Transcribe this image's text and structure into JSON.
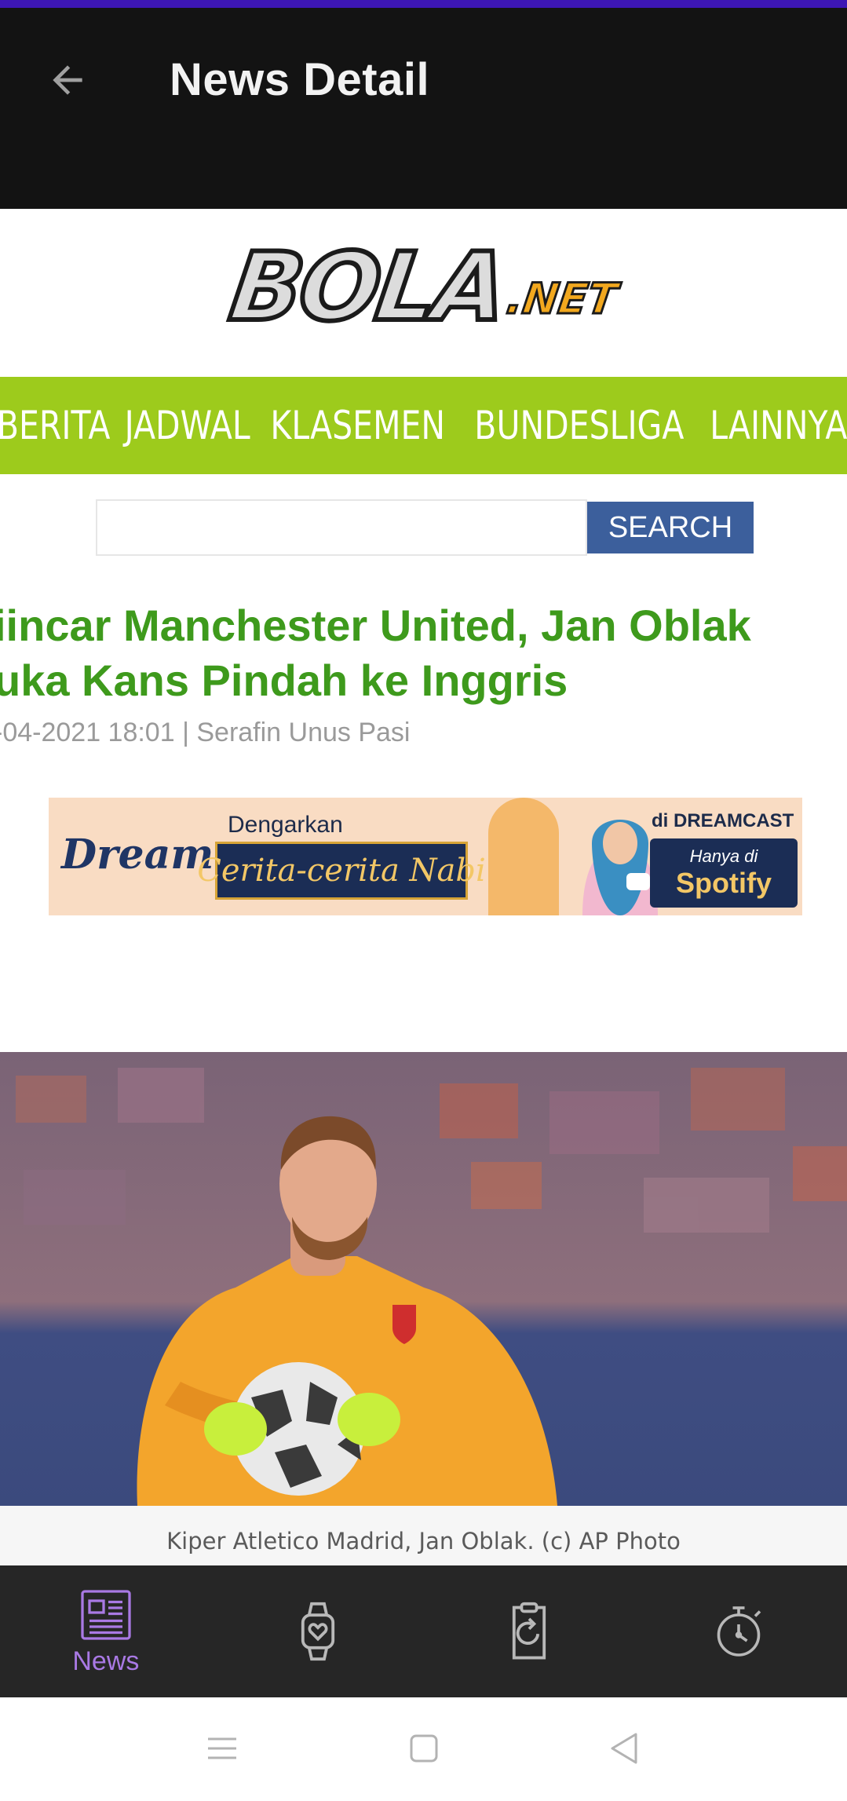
{
  "app_bar": {
    "title": "News Detail",
    "back_icon": "arrow-left-icon"
  },
  "site": {
    "logo_main": "BOLA",
    "logo_suffix": ".NET",
    "nav_items": [
      "BERITA",
      "JADWAL",
      "KLASEMEN",
      "BUNDESLIGA",
      "LAINNYA"
    ],
    "nav_color": "#9dcb1c"
  },
  "search": {
    "value": "",
    "button_label": "SEARCH"
  },
  "article": {
    "headline_line1": "iincar Manchester United, Jan Oblak",
    "headline_line2": "uka Kans Pindah ke Inggris",
    "meta": "-04-2021 18:01 | Serafin Unus Pasi",
    "headline_color": "#3e9a1c",
    "photo_caption": "Kiper Atletico Madrid, Jan Oblak. (c) AP Photo"
  },
  "banner": {
    "brand": "Dream",
    "line1": "Dengarkan",
    "highlight": "Cerita-cerita Nabi",
    "channel": "di DREAMCAST",
    "hanya": "Hanya di",
    "platform": "Spotify"
  },
  "bottom_nav": {
    "items": [
      {
        "label": "News",
        "icon": "newspaper-icon",
        "active": true
      },
      {
        "label": "",
        "icon": "smartwatch-icon",
        "active": false
      },
      {
        "label": "",
        "icon": "clipboard-refresh-icon",
        "active": false
      },
      {
        "label": "",
        "icon": "stopwatch-icon",
        "active": false
      }
    ],
    "active_color": "#a979e4"
  },
  "system_nav": {
    "icons": [
      "menu-icon",
      "home-square-icon",
      "back-triangle-icon"
    ]
  }
}
